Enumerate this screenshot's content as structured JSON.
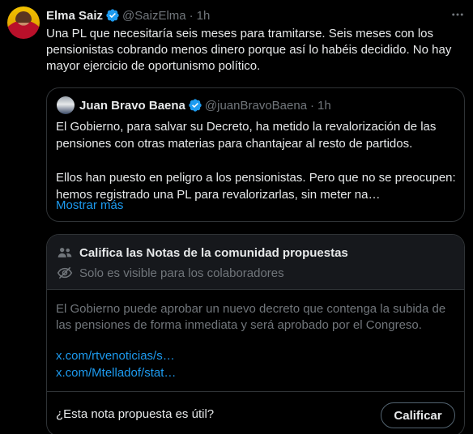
{
  "tweet": {
    "author_name": "Elma Saiz",
    "author_handle": "@SaizElma",
    "separator": "·",
    "time": "1h",
    "text": "Una PL que necesitaría seis meses para tramitarse. Seis meses con los pensionistas cobrando menos dinero porque así lo habéis decidido. No hay mayor ejercicio de oportunismo político.",
    "more_icon": "more-dots-icon"
  },
  "quoted_tweet": {
    "author_name": "Juan Bravo Baena",
    "author_handle": "@juanBravoBaena",
    "separator": "·",
    "time": "1h",
    "paragraph_1": "El Gobierno, para salvar su Decreto, ha metido la revalorización de las pensiones con otras materias para chantajear al resto de partidos.",
    "paragraph_2": "Ellos han puesto en peligro a los pensionistas. Pero que no se preocupen: hemos registrado una PL para revalorizarlas, sin meter na…",
    "show_more": "Mostrar más"
  },
  "community_notes": {
    "title": "Califica las Notas de la comunidad propuestas",
    "visibility": "Solo es visible para los colaboradores",
    "note_text": "El Gobierno puede aprobar un nuevo decreto que contenga la subida de las pensiones de forma inmediata y será aprobado por el Congreso.",
    "links": [
      "x.com/rtvenoticias/s…",
      "x.com/Mtelladof/stat…"
    ],
    "question": "¿Esta nota propuesta es útil?",
    "rate_button": "Calificar"
  },
  "colors": {
    "background": "#000000",
    "text": "#e7e9ea",
    "muted": "#71767b",
    "link": "#1d9bf0",
    "border": "#2f3336",
    "verified": "#1d9bf0"
  }
}
